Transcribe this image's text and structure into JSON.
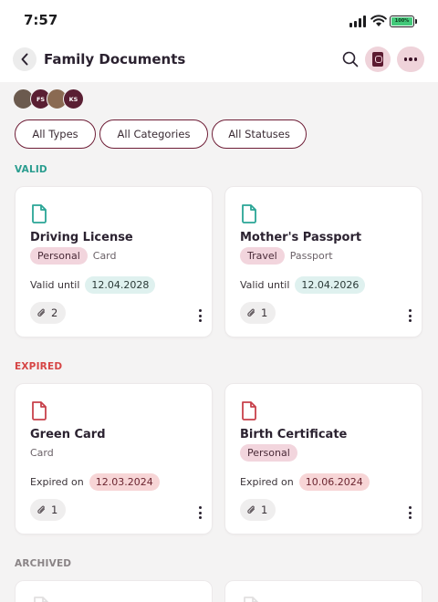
{
  "status_bar": {
    "time": "7:57",
    "battery_label": "100%"
  },
  "header": {
    "title": "Family Documents"
  },
  "avatars": [
    {
      "initials": "",
      "color": "#6b5a4e"
    },
    {
      "initials": "FS",
      "color": "#5a1f33"
    },
    {
      "initials": "",
      "color": "#8a6a52"
    },
    {
      "initials": "KS",
      "color": "#5a1f33"
    }
  ],
  "filters": [
    "All Types",
    "All Categories",
    "All Statuses"
  ],
  "sections": {
    "valid": {
      "label": "VALID",
      "color": "#2a9d8f",
      "cards": [
        {
          "title": "Driving License",
          "category": "Personal",
          "type": "Card",
          "status_text": "Valid until",
          "date": "12.04.2028",
          "attachments": "2"
        },
        {
          "title": "Mother's Passport",
          "category": "Travel",
          "type": "Passport",
          "status_text": "Valid until",
          "date": "12.04.2026",
          "attachments": "1"
        }
      ]
    },
    "expired": {
      "label": "EXPIRED",
      "color": "#d64545",
      "cards": [
        {
          "title": "Green Card",
          "category": "",
          "type": "Card",
          "status_text": "Expired on",
          "date": "12.03.2024",
          "attachments": "1"
        },
        {
          "title": "Birth Certificate",
          "category": "Personal",
          "type": "",
          "status_text": "Expired on",
          "date": "10.06.2024",
          "attachments": "1"
        }
      ]
    },
    "archived": {
      "label": "ARCHIVED",
      "color": "#8a8486"
    }
  },
  "colors": {
    "valid_icon": "#2aa596",
    "expired_icon": "#c8414b",
    "accent": "#6e1d36"
  }
}
